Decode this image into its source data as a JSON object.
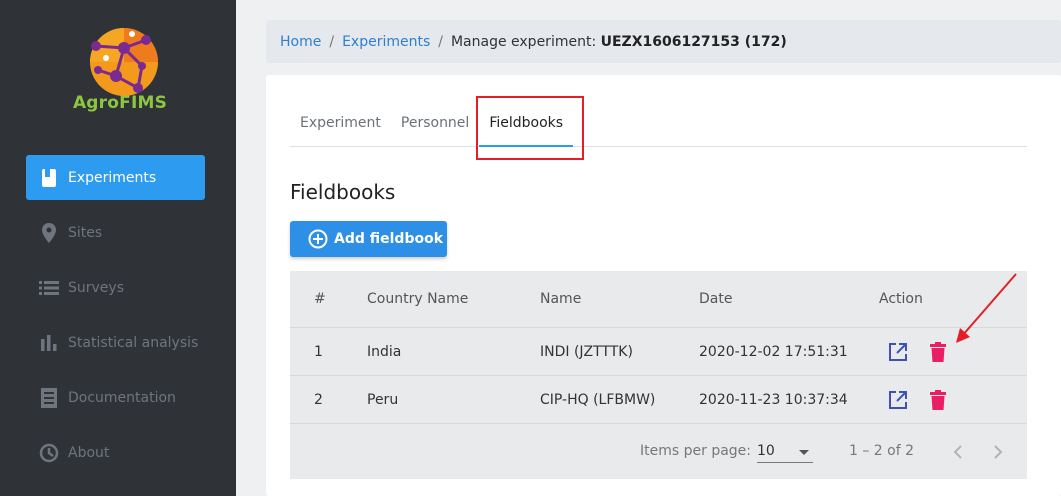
{
  "app": {
    "logo_text": "AgroFIMS"
  },
  "sidebar": {
    "items": [
      {
        "label": "Experiments",
        "icon": "book-icon",
        "active": true
      },
      {
        "label": "Sites",
        "icon": "map-pin-icon"
      },
      {
        "label": "Surveys",
        "icon": "list-icon"
      },
      {
        "label": "Statistical analysis",
        "icon": "bar-chart-icon"
      },
      {
        "label": "Documentation",
        "icon": "document-icon"
      },
      {
        "label": "About",
        "icon": "about-icon"
      }
    ]
  },
  "breadcrumb": {
    "home": "Home",
    "experiments": "Experiments",
    "current_prefix": "Manage experiment: ",
    "current_id": "UEZX1606127153 (172)"
  },
  "tabs": [
    {
      "label": "Experiment"
    },
    {
      "label": "Personnel"
    },
    {
      "label": "Fieldbooks",
      "active": true
    }
  ],
  "section": {
    "title": "Fieldbooks",
    "add_button": "Add fieldbook"
  },
  "table": {
    "headers": [
      "#",
      "Country Name",
      "Name",
      "Date",
      "Action"
    ],
    "rows": [
      {
        "num": "1",
        "country": "India",
        "name": "INDI (JZTTTK)",
        "date": "2020-12-02 17:51:31"
      },
      {
        "num": "2",
        "country": "Peru",
        "name": "CIP-HQ (LFBMW)",
        "date": "2020-11-23 10:37:34"
      }
    ]
  },
  "paginator": {
    "items_per_page_label": "Items per page:",
    "page_size": "10",
    "range": "1 – 2 of 2"
  },
  "colors": {
    "accent": "#2d9cf0",
    "sidebar_bg": "#2f3338",
    "delete": "#e91e63",
    "open": "#3f51b5",
    "highlight": "#e41e26"
  }
}
